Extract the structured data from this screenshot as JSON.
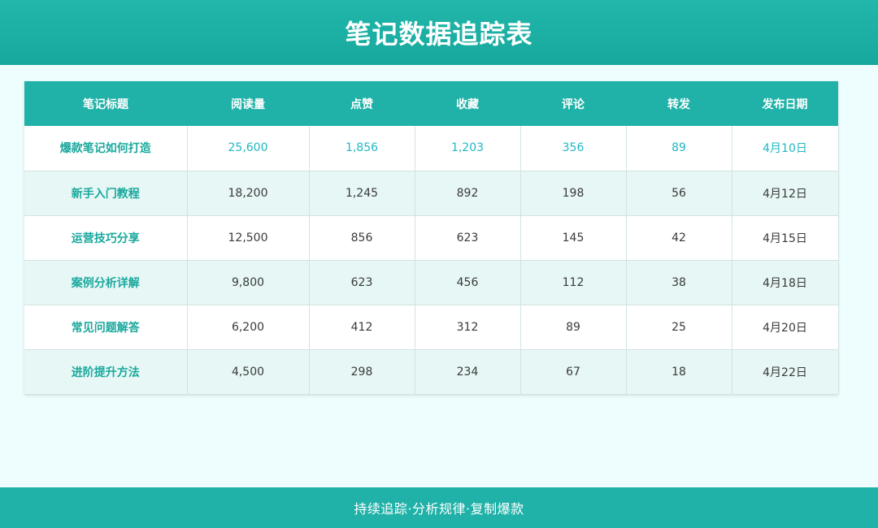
{
  "header": {
    "title": "笔记数据追踪表"
  },
  "table": {
    "columns": [
      "笔记标题",
      "阅读量",
      "点赞",
      "收藏",
      "评论",
      "转发",
      "发布日期"
    ],
    "rows": [
      [
        "爆款笔记如何打造",
        "25,600",
        "1,856",
        "1,203",
        "356",
        "89",
        "4月10日"
      ],
      [
        "新手入门教程",
        "18,200",
        "1,245",
        "892",
        "198",
        "56",
        "4月12日"
      ],
      [
        "运营技巧分享",
        "12,500",
        "856",
        "623",
        "145",
        "42",
        "4月15日"
      ],
      [
        "案例分析详解",
        "9,800",
        "623",
        "456",
        "112",
        "38",
        "4月18日"
      ],
      [
        "常见问题解答",
        "6,200",
        "412",
        "312",
        "89",
        "25",
        "4月20日"
      ],
      [
        "进阶提升方法",
        "4,500",
        "298",
        "234",
        "67",
        "18",
        "4月22日"
      ]
    ]
  },
  "footer": {
    "text": "持续追踪·分析规律·复制爆款"
  },
  "colors": {
    "header_bg": "#1faea3",
    "table_header_bg": "#20b2a8",
    "highlight_value": "#1fb8c4",
    "title_text": "#1aa89d",
    "even_row_bg": "#e6f7f5",
    "page_bg": "#eefdfd"
  }
}
